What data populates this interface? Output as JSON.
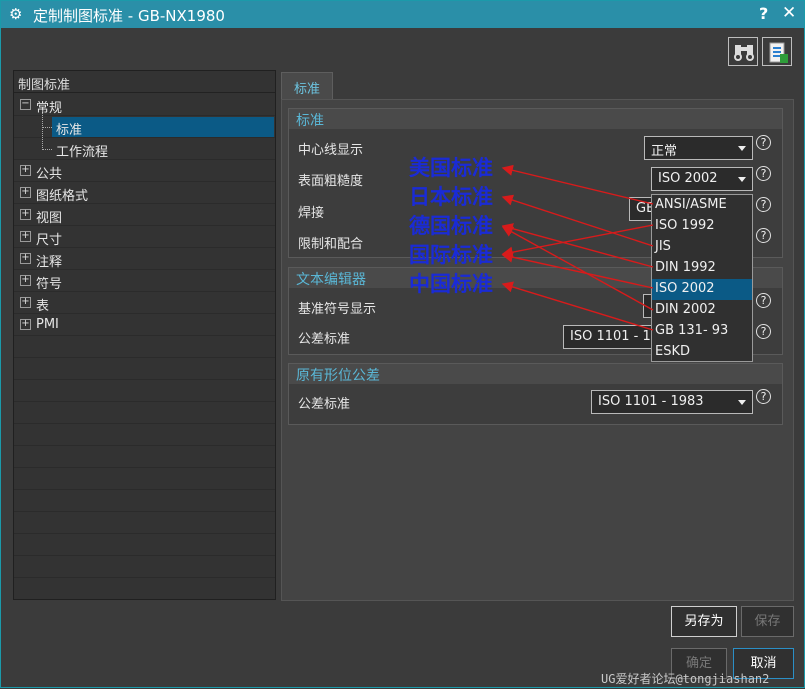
{
  "window": {
    "title": "定制制图标准 - GB-NX1980",
    "help": "?",
    "close": "✕"
  },
  "tree": {
    "header": "制图标准",
    "items": [
      {
        "label": "常规",
        "expander": "−"
      },
      {
        "label": "标准"
      },
      {
        "label": "工作流程"
      },
      {
        "label": "公共",
        "expander": "+"
      },
      {
        "label": "图纸格式",
        "expander": "+"
      },
      {
        "label": "视图",
        "expander": "+"
      },
      {
        "label": "尺寸",
        "expander": "+"
      },
      {
        "label": "注释",
        "expander": "+"
      },
      {
        "label": "符号",
        "expander": "+"
      },
      {
        "label": "表",
        "expander": "+"
      },
      {
        "label": "PMI",
        "expander": "+"
      }
    ]
  },
  "tab": {
    "label": "标准"
  },
  "groups": {
    "standard": {
      "title": "标准",
      "fields": {
        "centerline": {
          "label": "中心线显示",
          "value": "正常"
        },
        "roughness": {
          "label": "表面粗糙度",
          "value": "ISO 2002"
        },
        "welding": {
          "label": "焊接",
          "value": "GB"
        },
        "limits": {
          "label": "限制和配合",
          "value": ""
        }
      }
    },
    "texteditor": {
      "title": "文本编辑器",
      "fields": {
        "datum": {
          "label": "基准符号显示",
          "value": ""
        },
        "tolerance": {
          "label": "公差标准",
          "value": "ISO 1101 - 19"
        }
      }
    },
    "legacy": {
      "title": "原有形位公差",
      "fields": {
        "tolerance": {
          "label": "公差标准",
          "value": "ISO 1101 - 1983"
        }
      }
    }
  },
  "dropdown_options": [
    "ANSI/ASME",
    "ISO 1992",
    "JIS",
    "DIN 1992",
    "ISO 2002",
    "DIN 2002",
    "GB 131- 93",
    "ESKD"
  ],
  "dropdown_selected": "ISO 2002",
  "annotations": [
    "美国标准",
    "日本标准",
    "德国标准",
    "国际标准",
    "中国标准"
  ],
  "buttons": {
    "save_as": "另存为",
    "save": "保存",
    "ok": "确定",
    "cancel": "取消"
  },
  "watermark": "UG爱好者论坛@tongjiashan2",
  "colors": {
    "titlebar": "#2a8fa8",
    "selection": "#0b5a86",
    "group_title": "#5ab7d6",
    "annotation": "#1a2bd6",
    "arrow": "#d81b1b"
  },
  "icons": {
    "settings": "gear-icon",
    "search": "binoculars-icon",
    "info": "document-info-icon"
  }
}
